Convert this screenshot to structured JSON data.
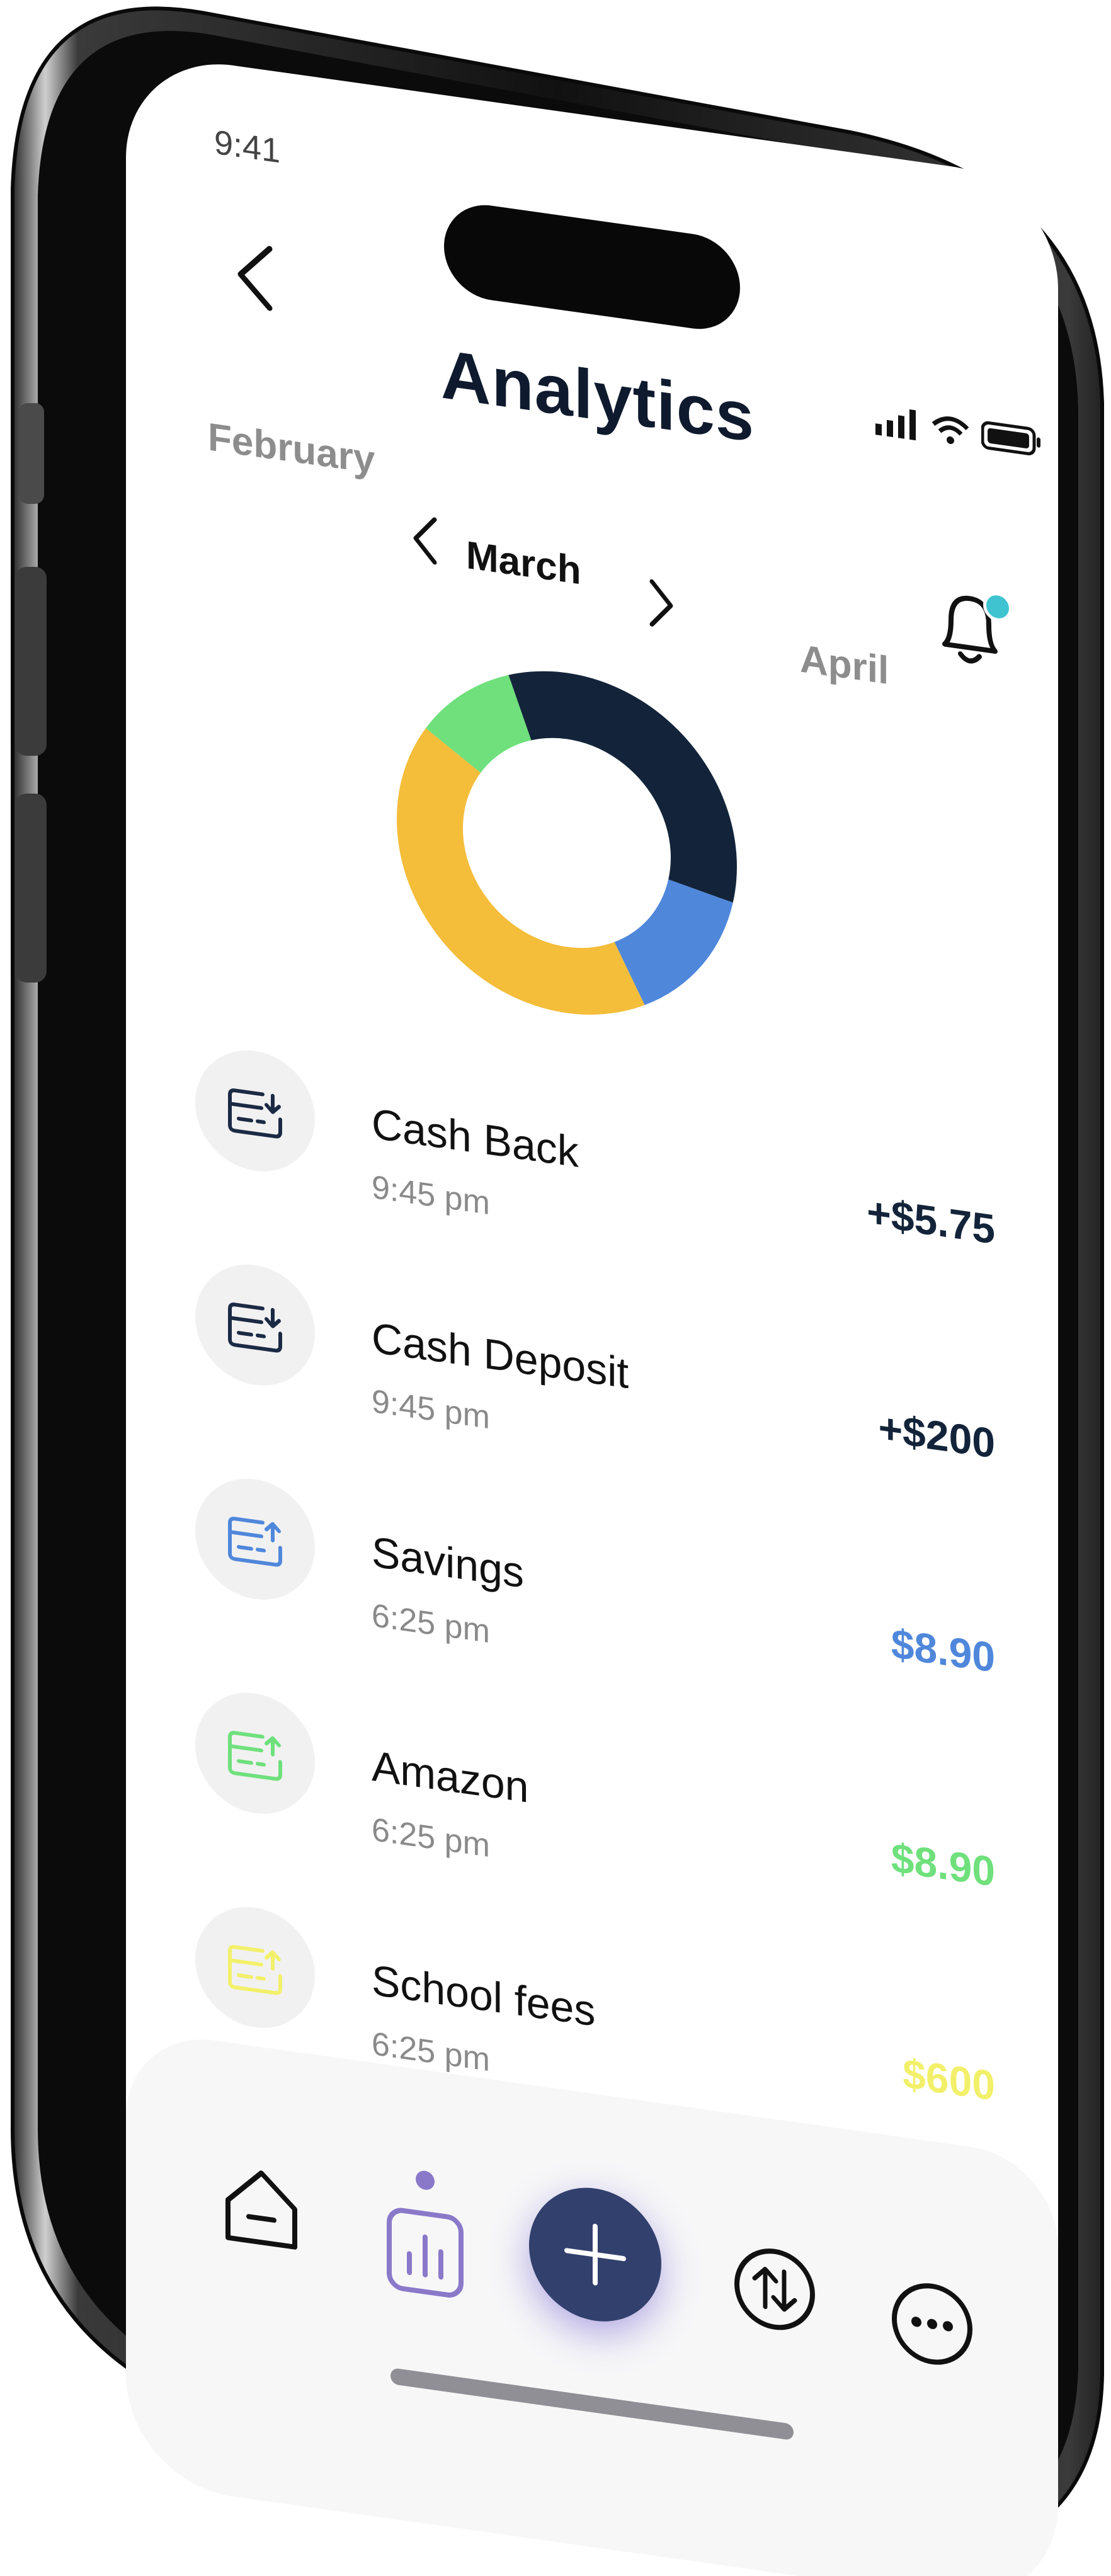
{
  "status_bar": {
    "time": "9:41"
  },
  "header": {
    "title": "Analytics"
  },
  "month_selector": {
    "previous": "February",
    "current": "March",
    "next": "April"
  },
  "colors": {
    "navy": "#13243a",
    "blue": "#4f87db",
    "yellow": "#f4bd3a",
    "green": "#6fe07c",
    "light_yellow": "#f2f06a",
    "accent_purple": "#8a79c9",
    "notification_dot": "#3fc3d1"
  },
  "chart_data": {
    "type": "pie",
    "variant": "donut",
    "values": [
      34,
      14,
      42,
      10
    ],
    "colors": [
      "#13243a",
      "#4f87db",
      "#f4bd3a",
      "#6fe07c"
    ]
  },
  "transactions": [
    {
      "title": "Cash Back",
      "time": "9:45 pm",
      "amount": "+$5.75",
      "amount_color": "#13243a",
      "icon": "card-download-icon",
      "icon_color": "#1b2a44"
    },
    {
      "title": "Cash Deposit",
      "time": "9:45 pm",
      "amount": "+$200",
      "amount_color": "#13243a",
      "icon": "card-download-icon",
      "icon_color": "#1b2a44"
    },
    {
      "title": "Savings",
      "time": "6:25 pm",
      "amount": "$8.90",
      "amount_color": "#4f87db",
      "icon": "card-upload-icon",
      "icon_color": "#4f87db"
    },
    {
      "title": "Amazon",
      "time": "6:25 pm",
      "amount": "$8.90",
      "amount_color": "#6fe07c",
      "icon": "card-upload-icon",
      "icon_color": "#6fe07c"
    },
    {
      "title": "School fees",
      "time": "6:25 pm",
      "amount": "$600",
      "amount_color": "#f2f06a",
      "icon": "card-upload-icon",
      "icon_color": "#f2f06a"
    }
  ],
  "bottom_nav": {
    "items": [
      {
        "name": "home",
        "icon": "home-icon"
      },
      {
        "name": "analytics",
        "icon": "bar-chart-icon",
        "active": true
      },
      {
        "name": "add",
        "icon": "plus-icon"
      },
      {
        "name": "transfer",
        "icon": "swap-arrows-icon"
      },
      {
        "name": "more",
        "icon": "more-dots-icon"
      }
    ]
  }
}
